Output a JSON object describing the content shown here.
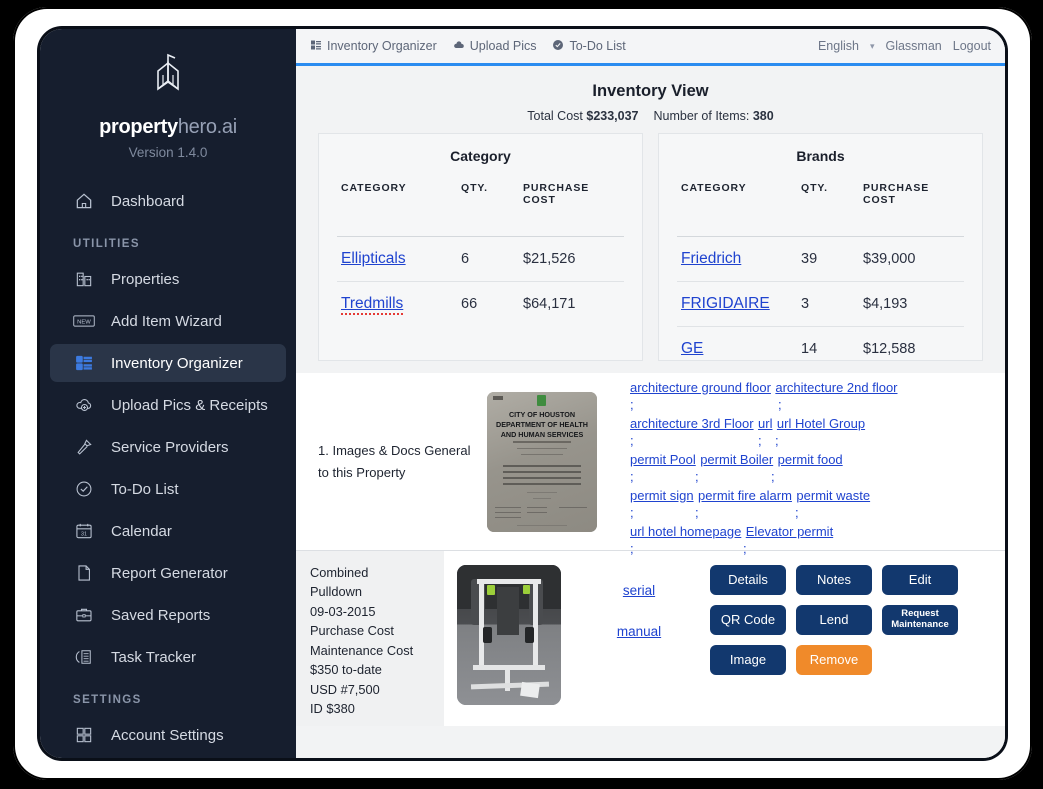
{
  "sidebar": {
    "brand_bold": "property",
    "brand_light": "hero.ai",
    "version": "Version 1.4.0",
    "dashboard": {
      "label": "Dashboard",
      "icon": "home-icon"
    },
    "section_utilities": "UTILITIES",
    "section_settings": "SETTINGS",
    "utilities": [
      {
        "label": "Properties",
        "icon": "building-icon"
      },
      {
        "label": "Add Item Wizard",
        "icon": "new-badge-icon"
      },
      {
        "label": "Inventory Organizer",
        "icon": "list-blocks-icon"
      },
      {
        "label": "Upload Pics & Receipts",
        "icon": "cloud-upload-icon"
      },
      {
        "label": "Service Providers",
        "icon": "hammer-icon"
      },
      {
        "label": "To-Do List",
        "icon": "check-circle-icon"
      },
      {
        "label": "Calendar",
        "icon": "calendar-icon"
      },
      {
        "label": "Report Generator",
        "icon": "document-icon"
      },
      {
        "label": "Saved Reports",
        "icon": "briefcase-icon"
      },
      {
        "label": "Task Tracker",
        "icon": "task-list-icon"
      }
    ],
    "settings": [
      {
        "label": "Account Settings",
        "icon": "grid-squares-icon"
      }
    ]
  },
  "topnav": {
    "items": [
      {
        "label": "Inventory Organizer",
        "icon": "blocks-icon"
      },
      {
        "label": "Upload Pics",
        "icon": "cloud-icon"
      },
      {
        "label": "To-Do List",
        "icon": "check-icon"
      }
    ],
    "language": "English",
    "user": "Glassman",
    "logout": "Logout"
  },
  "page": {
    "title": "Inventory View",
    "total_cost_label": "Total Cost",
    "total_cost_value": "$233,037",
    "items_label": "Number of Items:",
    "items_value": "380"
  },
  "category_table": {
    "title": "Category",
    "headers": [
      "CATEGORY",
      "QTY.",
      "PURCHASE COST"
    ],
    "rows": [
      {
        "name": "Ellipticals",
        "qty": "6",
        "cost": "$21,526",
        "misspelled": false
      },
      {
        "name": "Tredmills",
        "qty": "66",
        "cost": "$64,171",
        "misspelled": true
      }
    ]
  },
  "brands_table": {
    "title": "Brands",
    "headers": [
      "CATEGORY",
      "QTY.",
      "PURCHASE COST"
    ],
    "rows": [
      {
        "name": "Friedrich",
        "qty": "39",
        "cost": "$39,000"
      },
      {
        "name": "FRIGIDAIRE",
        "qty": "3",
        "cost": "$4,193"
      },
      {
        "name": "GE",
        "qty": "14",
        "cost": "$12,588"
      }
    ]
  },
  "docs_section": {
    "label": "1. Images & Docs General to this Property",
    "thumbnail_text": [
      "CITY OF HOUSTON",
      "DEPARTMENT OF HEALTH",
      "AND HUMAN SERVICES"
    ],
    "link_lines": [
      [
        "architecture ground floor",
        "architecture 2nd floor"
      ],
      [
        "architecture 3rd Floor",
        "url",
        "url Hotel Group"
      ],
      [
        "permit Pool",
        "permit Boiler",
        "permit food"
      ],
      [
        "permit sign",
        "permit fire alarm",
        "permit waste"
      ],
      [
        "url hotel homepage",
        "Elevator permit"
      ]
    ],
    "separator": ";"
  },
  "item": {
    "meta_lines": [
      "Combined",
      "Pulldown",
      "09-03-2015",
      "Purchase Cost",
      "Maintenance Cost",
      "$350 to-date",
      "USD #7,500",
      "ID $380"
    ],
    "links": [
      "serial",
      "manual"
    ],
    "buttons": [
      {
        "label": "Details",
        "style": "navy"
      },
      {
        "label": "Notes",
        "style": "navy"
      },
      {
        "label": "Edit",
        "style": "navy"
      },
      {
        "label": "QR Code",
        "style": "navy"
      },
      {
        "label": "Lend",
        "style": "navy"
      },
      {
        "label": "Request Maintenance",
        "style": "navy-small"
      },
      {
        "label": "Image",
        "style": "navy"
      },
      {
        "label": "Remove",
        "style": "orange"
      }
    ]
  },
  "colors": {
    "sidebar_bg": "#161e2e",
    "accent_blue": "#2a8cf0",
    "link_blue": "#1f43cf",
    "button_navy": "#12386e",
    "button_orange": "#f08a2a",
    "page_bg": "#f2f3f4"
  }
}
